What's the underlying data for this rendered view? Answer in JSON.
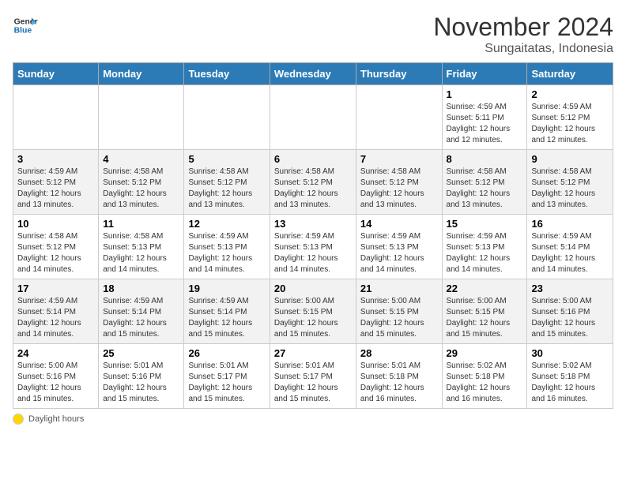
{
  "header": {
    "logo_general": "General",
    "logo_blue": "Blue",
    "month_title": "November 2024",
    "subtitle": "Sungaitatas, Indonesia"
  },
  "calendar": {
    "days_of_week": [
      "Sunday",
      "Monday",
      "Tuesday",
      "Wednesday",
      "Thursday",
      "Friday",
      "Saturday"
    ],
    "weeks": [
      [
        {
          "day": "",
          "info": ""
        },
        {
          "day": "",
          "info": ""
        },
        {
          "day": "",
          "info": ""
        },
        {
          "day": "",
          "info": ""
        },
        {
          "day": "",
          "info": ""
        },
        {
          "day": "1",
          "info": "Sunrise: 4:59 AM\nSunset: 5:11 PM\nDaylight: 12 hours and 12 minutes."
        },
        {
          "day": "2",
          "info": "Sunrise: 4:59 AM\nSunset: 5:12 PM\nDaylight: 12 hours and 12 minutes."
        }
      ],
      [
        {
          "day": "3",
          "info": "Sunrise: 4:59 AM\nSunset: 5:12 PM\nDaylight: 12 hours and 13 minutes."
        },
        {
          "day": "4",
          "info": "Sunrise: 4:58 AM\nSunset: 5:12 PM\nDaylight: 12 hours and 13 minutes."
        },
        {
          "day": "5",
          "info": "Sunrise: 4:58 AM\nSunset: 5:12 PM\nDaylight: 12 hours and 13 minutes."
        },
        {
          "day": "6",
          "info": "Sunrise: 4:58 AM\nSunset: 5:12 PM\nDaylight: 12 hours and 13 minutes."
        },
        {
          "day": "7",
          "info": "Sunrise: 4:58 AM\nSunset: 5:12 PM\nDaylight: 12 hours and 13 minutes."
        },
        {
          "day": "8",
          "info": "Sunrise: 4:58 AM\nSunset: 5:12 PM\nDaylight: 12 hours and 13 minutes."
        },
        {
          "day": "9",
          "info": "Sunrise: 4:58 AM\nSunset: 5:12 PM\nDaylight: 12 hours and 13 minutes."
        }
      ],
      [
        {
          "day": "10",
          "info": "Sunrise: 4:58 AM\nSunset: 5:12 PM\nDaylight: 12 hours and 14 minutes."
        },
        {
          "day": "11",
          "info": "Sunrise: 4:58 AM\nSunset: 5:13 PM\nDaylight: 12 hours and 14 minutes."
        },
        {
          "day": "12",
          "info": "Sunrise: 4:59 AM\nSunset: 5:13 PM\nDaylight: 12 hours and 14 minutes."
        },
        {
          "day": "13",
          "info": "Sunrise: 4:59 AM\nSunset: 5:13 PM\nDaylight: 12 hours and 14 minutes."
        },
        {
          "day": "14",
          "info": "Sunrise: 4:59 AM\nSunset: 5:13 PM\nDaylight: 12 hours and 14 minutes."
        },
        {
          "day": "15",
          "info": "Sunrise: 4:59 AM\nSunset: 5:13 PM\nDaylight: 12 hours and 14 minutes."
        },
        {
          "day": "16",
          "info": "Sunrise: 4:59 AM\nSunset: 5:14 PM\nDaylight: 12 hours and 14 minutes."
        }
      ],
      [
        {
          "day": "17",
          "info": "Sunrise: 4:59 AM\nSunset: 5:14 PM\nDaylight: 12 hours and 14 minutes."
        },
        {
          "day": "18",
          "info": "Sunrise: 4:59 AM\nSunset: 5:14 PM\nDaylight: 12 hours and 15 minutes."
        },
        {
          "day": "19",
          "info": "Sunrise: 4:59 AM\nSunset: 5:14 PM\nDaylight: 12 hours and 15 minutes."
        },
        {
          "day": "20",
          "info": "Sunrise: 5:00 AM\nSunset: 5:15 PM\nDaylight: 12 hours and 15 minutes."
        },
        {
          "day": "21",
          "info": "Sunrise: 5:00 AM\nSunset: 5:15 PM\nDaylight: 12 hours and 15 minutes."
        },
        {
          "day": "22",
          "info": "Sunrise: 5:00 AM\nSunset: 5:15 PM\nDaylight: 12 hours and 15 minutes."
        },
        {
          "day": "23",
          "info": "Sunrise: 5:00 AM\nSunset: 5:16 PM\nDaylight: 12 hours and 15 minutes."
        }
      ],
      [
        {
          "day": "24",
          "info": "Sunrise: 5:00 AM\nSunset: 5:16 PM\nDaylight: 12 hours and 15 minutes."
        },
        {
          "day": "25",
          "info": "Sunrise: 5:01 AM\nSunset: 5:16 PM\nDaylight: 12 hours and 15 minutes."
        },
        {
          "day": "26",
          "info": "Sunrise: 5:01 AM\nSunset: 5:17 PM\nDaylight: 12 hours and 15 minutes."
        },
        {
          "day": "27",
          "info": "Sunrise: 5:01 AM\nSunset: 5:17 PM\nDaylight: 12 hours and 15 minutes."
        },
        {
          "day": "28",
          "info": "Sunrise: 5:01 AM\nSunset: 5:18 PM\nDaylight: 12 hours and 16 minutes."
        },
        {
          "day": "29",
          "info": "Sunrise: 5:02 AM\nSunset: 5:18 PM\nDaylight: 12 hours and 16 minutes."
        },
        {
          "day": "30",
          "info": "Sunrise: 5:02 AM\nSunset: 5:18 PM\nDaylight: 12 hours and 16 minutes."
        }
      ]
    ]
  },
  "footer": {
    "daylight_label": "Daylight hours"
  }
}
